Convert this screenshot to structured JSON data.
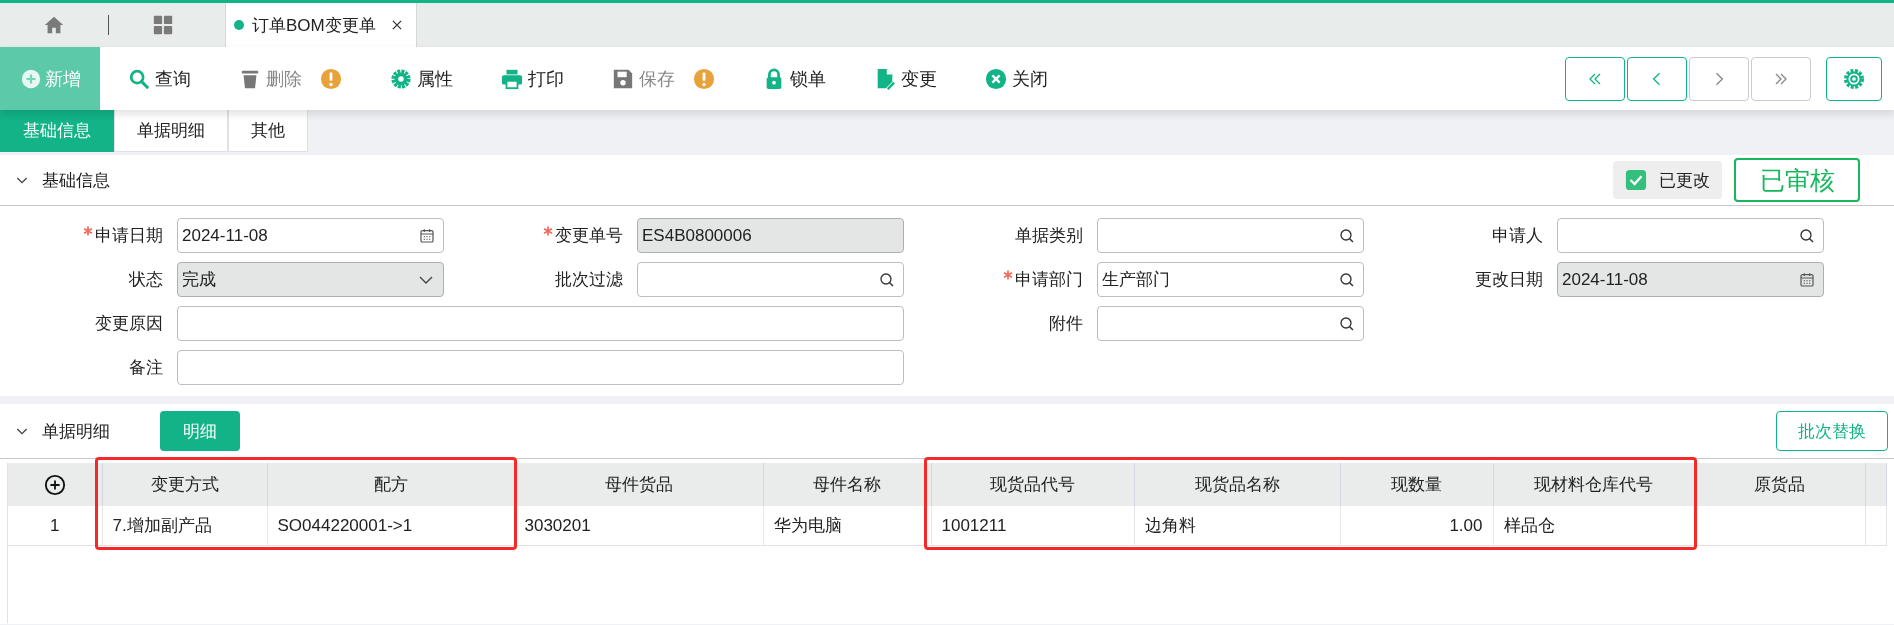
{
  "top_tabs": [
    {
      "kind": "home",
      "selected": false
    },
    {
      "kind": "grid",
      "selected": false
    },
    {
      "kind": "document",
      "label": "订单BOM变更单",
      "selected": true
    }
  ],
  "toolbar": [
    {
      "kind": "add",
      "label": "新增",
      "disabled": true,
      "warning": false
    },
    {
      "kind": "search",
      "label": "查询",
      "disabled": false,
      "warning": false
    },
    {
      "kind": "delete",
      "label": "删除",
      "disabled": true,
      "warning": true
    },
    {
      "kind": "properties",
      "label": "属性",
      "disabled": false,
      "warning": false
    },
    {
      "kind": "print",
      "label": "打印",
      "disabled": false,
      "warning": false
    },
    {
      "kind": "save",
      "label": "保存",
      "disabled": true,
      "warning": true
    },
    {
      "kind": "lock",
      "label": "锁单",
      "disabled": false,
      "warning": false
    },
    {
      "kind": "change",
      "label": "变更",
      "disabled": false,
      "warning": false
    },
    {
      "kind": "close",
      "label": "关闭",
      "disabled": false,
      "warning": false
    }
  ],
  "nav_buttons": [
    {
      "kind": "first",
      "disabled": false
    },
    {
      "kind": "prev",
      "disabled": false
    },
    {
      "kind": "next",
      "disabled": true
    },
    {
      "kind": "last",
      "disabled": true
    }
  ],
  "form_tabs": [
    {
      "label": "基础信息",
      "selected": true
    },
    {
      "label": "单据明细",
      "selected": false
    },
    {
      "label": "其他",
      "selected": false
    }
  ],
  "basic_section": {
    "title": "基础信息",
    "expanded": true,
    "modified": {
      "label": "已更改",
      "checked": true
    },
    "status_stamp": "已审核",
    "fields": [
      {
        "label": "申请日期",
        "required": true,
        "kind": "date",
        "readonly": false,
        "value": "2024-11-08"
      },
      {
        "label": "变更单号",
        "required": true,
        "kind": "text",
        "readonly": true,
        "value": "ES4B0800006"
      },
      {
        "label": "单据类别",
        "required": false,
        "kind": "lookup",
        "readonly": false
      },
      {
        "label": "申请人",
        "required": false,
        "kind": "lookup",
        "readonly": false
      },
      {
        "label": "状态",
        "required": false,
        "kind": "select",
        "readonly": true,
        "value": "完成"
      },
      {
        "label": "批次过滤",
        "required": false,
        "kind": "lookup",
        "readonly": false
      },
      {
        "label": "申请部门",
        "required": true,
        "kind": "lookup",
        "readonly": false,
        "value": "生产部门"
      },
      {
        "label": "更改日期",
        "required": false,
        "kind": "date",
        "readonly": true,
        "value": "2024-11-08"
      },
      {
        "label": "变更原因",
        "required": false,
        "kind": "long",
        "readonly": false
      },
      {
        "label": "附件",
        "required": false,
        "kind": "lookup",
        "readonly": false
      },
      {
        "label": "备注",
        "required": false,
        "kind": "long",
        "readonly": false
      }
    ]
  },
  "detail_section": {
    "title": "单据明细",
    "expanded": true,
    "tab_button": "明细",
    "action_button": "批次替换",
    "table": {
      "columns": [
        {
          "label": "变更方式",
          "kind": "text",
          "highlighted": true
        },
        {
          "label": "配方",
          "kind": "text",
          "highlighted": true
        },
        {
          "label": "母件货品",
          "kind": "text",
          "highlighted": false
        },
        {
          "label": "母件名称",
          "kind": "text",
          "highlighted": false
        },
        {
          "label": "现货品代号",
          "kind": "text",
          "highlighted": true
        },
        {
          "label": "现货品名称",
          "kind": "text",
          "highlighted": true
        },
        {
          "label": "现数量",
          "kind": "number",
          "highlighted": true
        },
        {
          "label": "现材料仓库代号",
          "kind": "text",
          "highlighted": true
        },
        {
          "label": "原货品",
          "kind": "text",
          "highlighted": false
        }
      ],
      "rows": [
        {
          "number": "1",
          "cells": [
            "7.增加副产品",
            "SO044220001->1",
            "3030201",
            "华为电脑",
            "1001211",
            "边角料",
            "1.00",
            "样品仓"
          ]
        }
      ]
    }
  }
}
